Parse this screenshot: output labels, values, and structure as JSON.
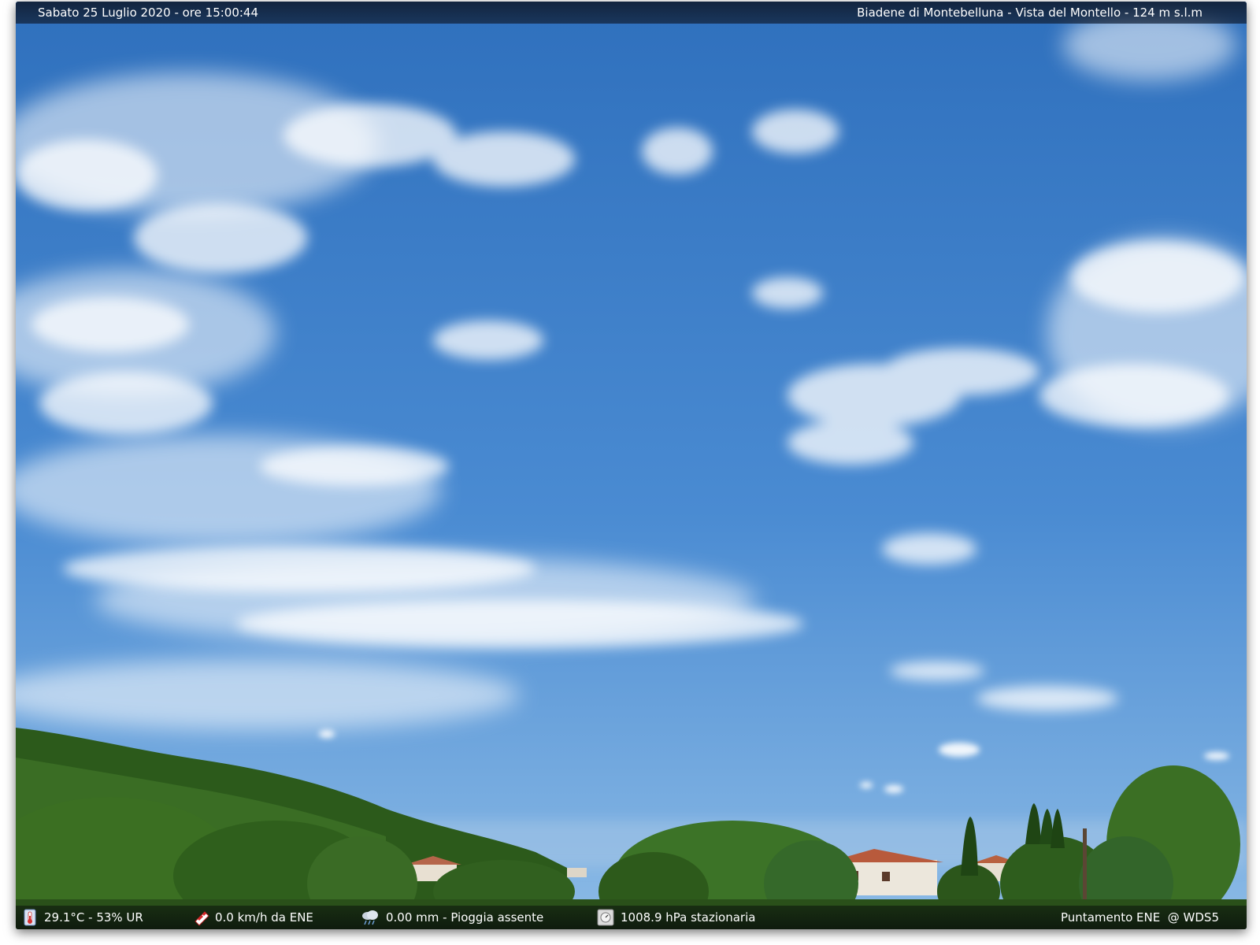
{
  "header": {
    "datetime": "Sabato 25 Luglio 2020 - ore 15:00:44",
    "location": "Biadene di Montebelluna - Vista del Montello - 124 m s.l.m"
  },
  "footer": {
    "temperature_humidity": "29.1°C - 53% UR",
    "wind": "0.0 km/h da ENE",
    "rain": "0.00 mm - Pioggia assente",
    "pressure": "1008.9 hPa stazionaria",
    "pointing": "Puntamento ENE  @ WDS5"
  },
  "icons": {
    "temperature": "thermometer-icon",
    "wind": "windsock-icon",
    "rain": "rain-cloud-icon",
    "pressure": "barometer-icon"
  },
  "colors": {
    "sky_top": "#2f70bd",
    "sky_bottom": "#6fa6dc",
    "vegetation": "#2f5a1e"
  }
}
